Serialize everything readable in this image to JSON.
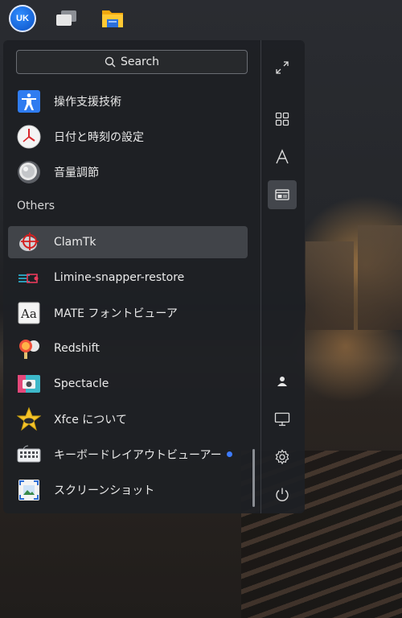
{
  "search": {
    "label": "Search"
  },
  "favorites": [
    {
      "label": "操作支援技術",
      "icon": "accessibility-icon"
    },
    {
      "label": "日付と時刻の設定",
      "icon": "clock-icon"
    },
    {
      "label": "音量調節",
      "icon": "volume-icon"
    }
  ],
  "section": {
    "title": "Others"
  },
  "others": [
    {
      "label": "ClamTk",
      "icon": "clamtk-icon",
      "selected": true
    },
    {
      "label": "Limine-snapper-restore",
      "icon": "limine-icon"
    },
    {
      "label": "MATE フォントビューア",
      "icon": "font-viewer-icon"
    },
    {
      "label": "Redshift",
      "icon": "redshift-icon"
    },
    {
      "label": "Spectacle",
      "icon": "spectacle-icon"
    },
    {
      "label": "Xfce について",
      "icon": "xfce-icon"
    },
    {
      "label": "キーボードレイアウトビューアー",
      "icon": "keyboard-icon",
      "new_indicator": true
    },
    {
      "label": "スクリーンショット",
      "icon": "screenshot-icon"
    }
  ],
  "sidebar": {
    "top": [
      "expand-icon",
      "apps-grid-icon",
      "font-a-icon",
      "panel-icon"
    ],
    "bottom": [
      "user-icon",
      "display-icon",
      "settings-gear-icon",
      "power-icon"
    ],
    "active": "panel-icon"
  },
  "topbar": {
    "logo_text": "UK",
    "items": [
      "ukui-menu-icon",
      "multitask-view-icon",
      "file-manager-icon"
    ]
  },
  "colors": {
    "menu_bg": "#1e2024",
    "accent_dot": "#3d7bff",
    "selected_bg": "#5f6268"
  }
}
